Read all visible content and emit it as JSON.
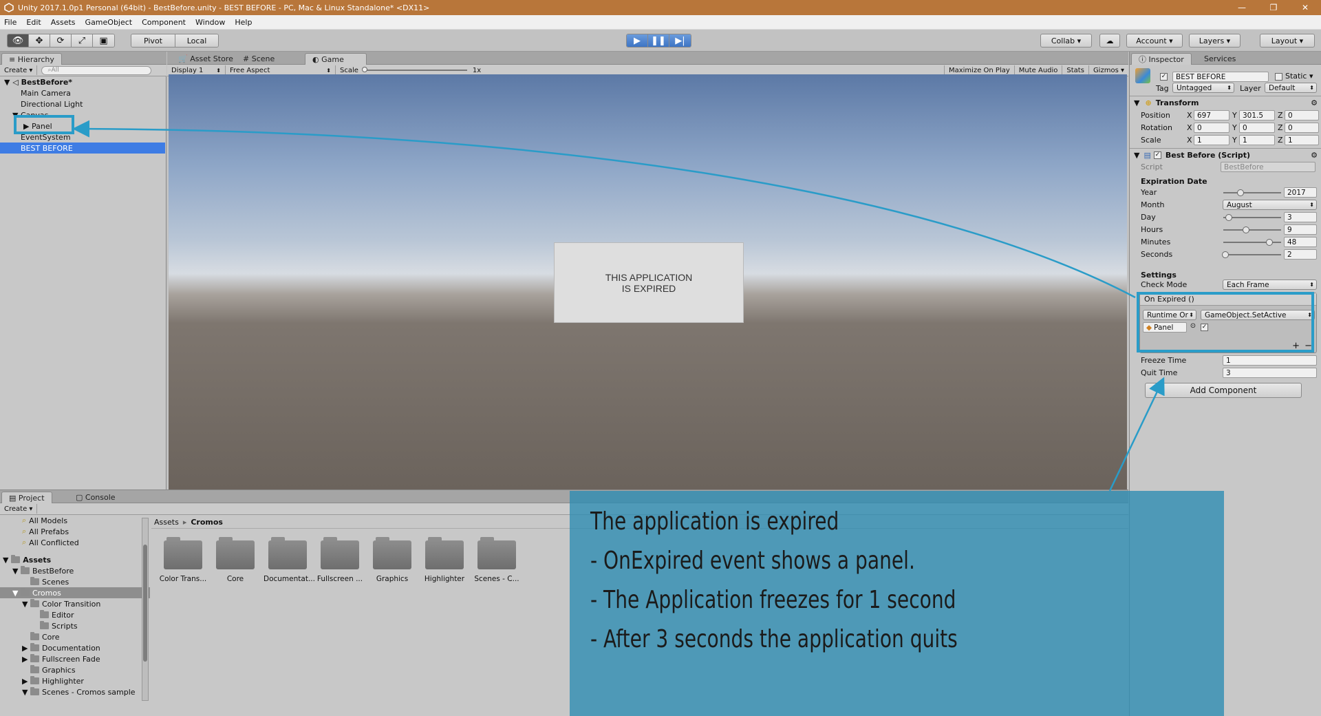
{
  "window": {
    "title": "Unity 2017.1.0p1 Personal (64bit) - BestBefore.unity - BEST BEFORE - PC, Mac & Linux Standalone* <DX11>",
    "minimize": "—",
    "maximize": "❐",
    "close": "✕"
  },
  "menu": [
    "File",
    "Edit",
    "Assets",
    "GameObject",
    "Component",
    "Window",
    "Help"
  ],
  "toolbar": {
    "pivot": "Pivot",
    "local": "Local",
    "collab": "Collab",
    "account": "Account",
    "layers": "Layers",
    "layout": "Layout"
  },
  "hierarchy": {
    "tab": "Hierarchy",
    "create": "Create",
    "search_placeholder": "All",
    "scene": "BestBefore*",
    "items": [
      "Main Camera",
      "Directional Light",
      "Canvas",
      "Panel",
      "EventSystem",
      "BEST BEFORE"
    ]
  },
  "view_tabs": {
    "asset_store": "Asset Store",
    "scene": "Scene",
    "game": "Game",
    "display": "Display 1",
    "aspect": "Free Aspect",
    "scale_label": "Scale",
    "scale_value": "1x",
    "maximize": "Maximize On Play",
    "mute": "Mute Audio",
    "stats": "Stats",
    "gizmos": "Gizmos"
  },
  "game_panel": {
    "line1": "THIS APPLICATION",
    "line2": "IS EXPIRED"
  },
  "inspector": {
    "tab": "Inspector",
    "services_tab": "Services",
    "object_name": "BEST BEFORE",
    "static_label": "Static",
    "tag_label": "Tag",
    "tag_value": "Untagged",
    "layer_label": "Layer",
    "layer_value": "Default",
    "transform": {
      "title": "Transform",
      "position_label": "Position",
      "position": [
        "697",
        "301.5",
        "0"
      ],
      "rotation_label": "Rotation",
      "rotation": [
        "0",
        "0",
        "0"
      ],
      "scale_label": "Scale",
      "scale": [
        "1",
        "1",
        "1"
      ]
    },
    "script_component": {
      "title": "Best Before (Script)",
      "script_label": "Script",
      "script_value": "BestBefore",
      "expiration_header": "Expiration Date",
      "year_label": "Year",
      "year": "2017",
      "year_fraction": 0.3,
      "month_label": "Month",
      "month": "August",
      "day_label": "Day",
      "day": "3",
      "day_fraction": 0.1,
      "hours_label": "Hours",
      "hours": "9",
      "hours_fraction": 0.39,
      "minutes_label": "Minutes",
      "minutes": "48",
      "minutes_fraction": 0.8,
      "seconds_label": "Seconds",
      "seconds": "2",
      "seconds_fraction": 0.03,
      "settings_header": "Settings",
      "check_mode_label": "Check Mode",
      "check_mode": "Each Frame",
      "event_label": "On Expired ()",
      "runtime": "Runtime Or",
      "function": "GameObject.SetActive",
      "target": "Panel",
      "freeze_label": "Freeze Time",
      "freeze": "1",
      "quit_label": "Quit Time",
      "quit": "3"
    },
    "add_component": "Add Component"
  },
  "project": {
    "tab": "Project",
    "console_tab": "Console",
    "create": "Create",
    "favorites": [
      "All Models",
      "All Prefabs",
      "All Conflicted"
    ],
    "tree": [
      {
        "label": "Assets",
        "indent": 0,
        "bold": true
      },
      {
        "label": "BestBefore",
        "indent": 1
      },
      {
        "label": "Scenes",
        "indent": 2
      },
      {
        "label": "Cromos",
        "indent": 1,
        "selected": true
      },
      {
        "label": "Color Transition",
        "indent": 2
      },
      {
        "label": "Editor",
        "indent": 3
      },
      {
        "label": "Scripts",
        "indent": 3
      },
      {
        "label": "Core",
        "indent": 2
      },
      {
        "label": "Documentation",
        "indent": 2
      },
      {
        "label": "Fullscreen Fade",
        "indent": 2
      },
      {
        "label": "Graphics",
        "indent": 2
      },
      {
        "label": "Highlighter",
        "indent": 2
      },
      {
        "label": "Scenes - Cromos sample",
        "indent": 2
      }
    ],
    "breadcrumb_root": "Assets",
    "breadcrumb_sep": "▸",
    "breadcrumb_current": "Cromos",
    "folders": [
      "Color Trans...",
      "Core",
      "Documentat...",
      "Fullscreen ...",
      "Graphics",
      "Highlighter",
      "Scenes - C..."
    ]
  },
  "callout": {
    "line1": "The  application is expired",
    "line2": "- OnExpired event shows a panel.",
    "line3": "- The Application freezes for 1 second",
    "line4": "- After 3 seconds the application quits"
  },
  "colors": {
    "titlebar": "#b8763a",
    "selection": "#3e7ce4",
    "callout": "#2b8cb2"
  }
}
